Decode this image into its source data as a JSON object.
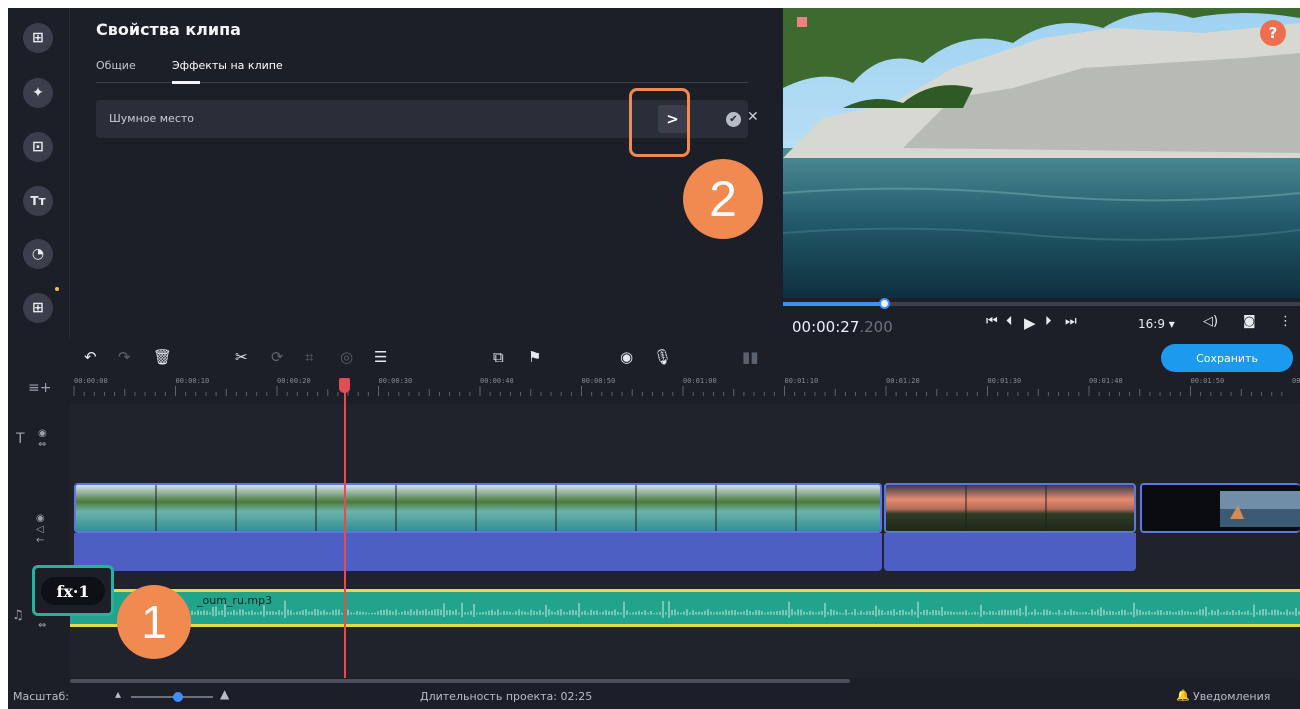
{
  "props": {
    "title": "Свойства клипа",
    "tabs": [
      {
        "label": "Общие"
      },
      {
        "label": "Эффекты на клипе"
      }
    ],
    "effect": {
      "name": "Шумное место",
      "open": ">",
      "confirm": "✔",
      "remove": "✕"
    }
  },
  "badges": {
    "one": "1",
    "two": "2"
  },
  "rail": {
    "icons": [
      "import-icon",
      "filters-icon",
      "transitions-icon",
      "titles-icon",
      "stickers-icon",
      "more-tools-icon"
    ],
    "labels": [
      "⊞",
      "✦",
      "⊡",
      "Tт",
      "◔",
      "⊞"
    ]
  },
  "preview": {
    "help": "?",
    "progress": 0.195,
    "time": "00:00:27",
    "time_ms": ".200",
    "aspect": "16:9 ▾"
  },
  "toolbar": {
    "save": "Сохранить"
  },
  "ruler": {
    "ticks": [
      "00:00:00",
      "00:00:10",
      "00:00:20",
      "00:00:30",
      "00:00:40",
      "00:00:50",
      "00:01:00",
      "00:01:10",
      "00:01:20",
      "00:01:30",
      "00:01:40",
      "00:01:50",
      "00"
    ]
  },
  "audio": {
    "file": "_oum_ru.mp3"
  },
  "fx": {
    "label": "fx·1"
  },
  "status": {
    "scale_label": "Масштаб:",
    "duration": "Длительность проекта: 02:25",
    "notifications": "Уведомления"
  },
  "colors": {
    "accent": "#1c9aee",
    "highlight": "#f08a50",
    "clip_border": "#6175e2",
    "audio": "#22a38b",
    "fx_frame": "#27b39a"
  }
}
